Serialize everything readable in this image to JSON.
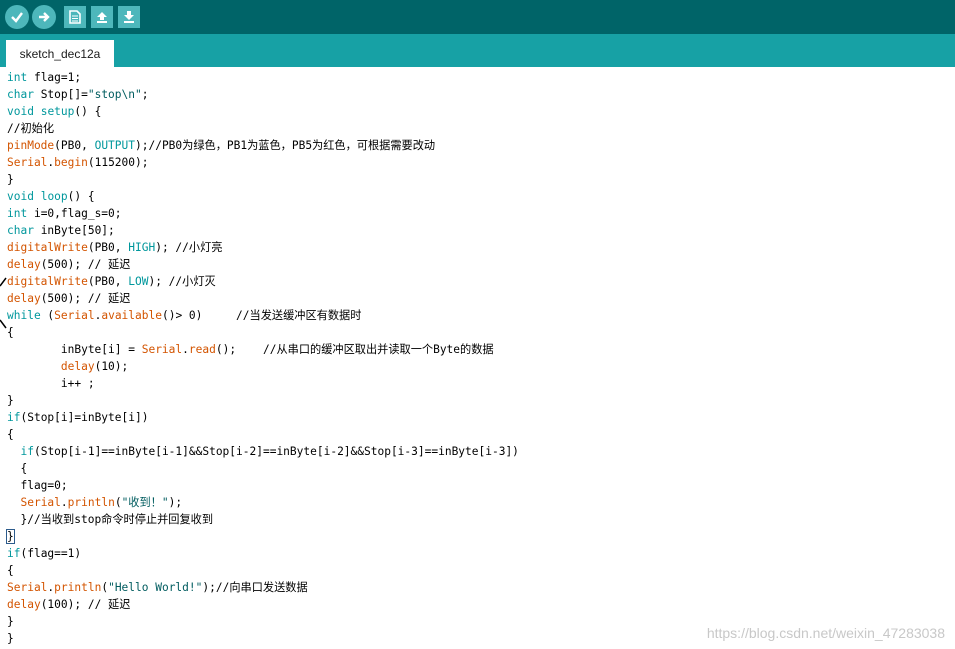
{
  "toolbar": {
    "buttons": [
      {
        "name": "verify",
        "icon": "check-icon"
      },
      {
        "name": "upload",
        "icon": "arrow-right-icon"
      },
      {
        "name": "new",
        "icon": "new-file-icon"
      },
      {
        "name": "open",
        "icon": "open-arrow-up-icon"
      },
      {
        "name": "save",
        "icon": "save-arrow-down-icon"
      }
    ],
    "colors": {
      "background": "#006468",
      "button": "#4db7bb"
    }
  },
  "tabs": [
    {
      "label": "sketch_dec12a",
      "active": true
    }
  ],
  "colors": {
    "tab_bar": "#17a1a5",
    "keyword": "#00979c",
    "function": "#d35400",
    "string": "#005c5f"
  },
  "code_lines": [
    [
      {
        "t": "int",
        "k": "keyword"
      },
      {
        "t": " flag=1;",
        "k": "plain"
      }
    ],
    [
      {
        "t": "char",
        "k": "keyword"
      },
      {
        "t": " Stop[]=",
        "k": "plain"
      },
      {
        "t": "\"stop\\n\"",
        "k": "string"
      },
      {
        "t": ";",
        "k": "plain"
      }
    ],
    [
      {
        "t": "void",
        "k": "keyword"
      },
      {
        "t": " ",
        "k": "plain"
      },
      {
        "t": "setup",
        "k": "keyword"
      },
      {
        "t": "() {",
        "k": "plain"
      }
    ],
    [
      {
        "t": "//初始化",
        "k": "plain"
      }
    ],
    [
      {
        "t": "pinMode",
        "k": "func"
      },
      {
        "t": "(PB0, ",
        "k": "plain"
      },
      {
        "t": "OUTPUT",
        "k": "const"
      },
      {
        "t": ");//PB0为绿色，PB1为蓝色，PB5为红色，可根据需要改动",
        "k": "plain"
      }
    ],
    [
      {
        "t": "Serial",
        "k": "func"
      },
      {
        "t": ".",
        "k": "plain"
      },
      {
        "t": "begin",
        "k": "func"
      },
      {
        "t": "(115200);",
        "k": "plain"
      }
    ],
    [
      {
        "t": "}",
        "k": "plain"
      }
    ],
    [
      {
        "t": "void",
        "k": "keyword"
      },
      {
        "t": " ",
        "k": "plain"
      },
      {
        "t": "loop",
        "k": "keyword"
      },
      {
        "t": "() {",
        "k": "plain"
      }
    ],
    [
      {
        "t": "int",
        "k": "keyword"
      },
      {
        "t": " i=0,flag_s=0;",
        "k": "plain"
      }
    ],
    [
      {
        "t": "char",
        "k": "keyword"
      },
      {
        "t": " inByte[50];",
        "k": "plain"
      }
    ],
    [
      {
        "t": "digitalWrite",
        "k": "func"
      },
      {
        "t": "(PB0, ",
        "k": "plain"
      },
      {
        "t": "HIGH",
        "k": "const"
      },
      {
        "t": "); //小灯亮",
        "k": "plain"
      }
    ],
    [
      {
        "t": "delay",
        "k": "func"
      },
      {
        "t": "(500); // 延迟",
        "k": "plain"
      }
    ],
    [
      {
        "t": "digitalWrite",
        "k": "func"
      },
      {
        "t": "(PB0, ",
        "k": "plain"
      },
      {
        "t": "LOW",
        "k": "const"
      },
      {
        "t": "); //小灯灭",
        "k": "plain"
      }
    ],
    [
      {
        "t": "delay",
        "k": "func"
      },
      {
        "t": "(500); // 延迟",
        "k": "plain"
      }
    ],
    [
      {
        "t": "while",
        "k": "keyword"
      },
      {
        "t": " (",
        "k": "plain"
      },
      {
        "t": "Serial",
        "k": "func"
      },
      {
        "t": ".",
        "k": "plain"
      },
      {
        "t": "available",
        "k": "func"
      },
      {
        "t": "()> 0)     //当发送缓冲区有数据时",
        "k": "plain"
      }
    ],
    [
      {
        "t": "{",
        "k": "plain"
      }
    ],
    [
      {
        "t": "        inByte[i] = ",
        "k": "plain"
      },
      {
        "t": "Serial",
        "k": "func"
      },
      {
        "t": ".",
        "k": "plain"
      },
      {
        "t": "read",
        "k": "func"
      },
      {
        "t": "();    //从串口的缓冲区取出并读取一个Byte的数据",
        "k": "plain"
      }
    ],
    [
      {
        "t": "        ",
        "k": "plain"
      },
      {
        "t": "delay",
        "k": "func"
      },
      {
        "t": "(10);",
        "k": "plain"
      }
    ],
    [
      {
        "t": "        i++ ;",
        "k": "plain"
      }
    ],
    [
      {
        "t": "}",
        "k": "plain"
      }
    ],
    [
      {
        "t": "if",
        "k": "keyword"
      },
      {
        "t": "(Stop[i]=inByte[i])",
        "k": "plain"
      }
    ],
    [
      {
        "t": "{",
        "k": "plain"
      }
    ],
    [
      {
        "t": "  ",
        "k": "plain"
      },
      {
        "t": "if",
        "k": "keyword"
      },
      {
        "t": "(Stop[i-1]==inByte[i-1]&&Stop[i-2]==inByte[i-2]&&Stop[i-3]==inByte[i-3])",
        "k": "plain"
      }
    ],
    [
      {
        "t": "  {",
        "k": "plain"
      }
    ],
    [
      {
        "t": "  flag=0;",
        "k": "plain"
      }
    ],
    [
      {
        "t": "  ",
        "k": "plain"
      },
      {
        "t": "Serial",
        "k": "func"
      },
      {
        "t": ".",
        "k": "plain"
      },
      {
        "t": "println",
        "k": "func"
      },
      {
        "t": "(",
        "k": "plain"
      },
      {
        "t": "\"收到！\"",
        "k": "string"
      },
      {
        "t": ");",
        "k": "plain"
      }
    ],
    [
      {
        "t": "  }//当收到stop命令时停止并回复收到",
        "k": "plain"
      }
    ],
    [
      {
        "t": "}",
        "k": "bracket"
      }
    ],
    [
      {
        "t": "if",
        "k": "keyword"
      },
      {
        "t": "(flag==1)",
        "k": "plain"
      }
    ],
    [
      {
        "t": "{",
        "k": "plain"
      }
    ],
    [
      {
        "t": "Serial",
        "k": "func"
      },
      {
        "t": ".",
        "k": "plain"
      },
      {
        "t": "println",
        "k": "func"
      },
      {
        "t": "(",
        "k": "plain"
      },
      {
        "t": "\"Hello World!\"",
        "k": "string"
      },
      {
        "t": ");//向串口发送数据",
        "k": "plain"
      }
    ],
    [
      {
        "t": "delay",
        "k": "func"
      },
      {
        "t": "(100); // 延迟",
        "k": "plain"
      }
    ],
    [
      {
        "t": "}",
        "k": "plain"
      }
    ],
    [
      {
        "t": "}",
        "k": "plain"
      }
    ]
  ],
  "watermark": "https://blog.csdn.net/weixin_47283038"
}
